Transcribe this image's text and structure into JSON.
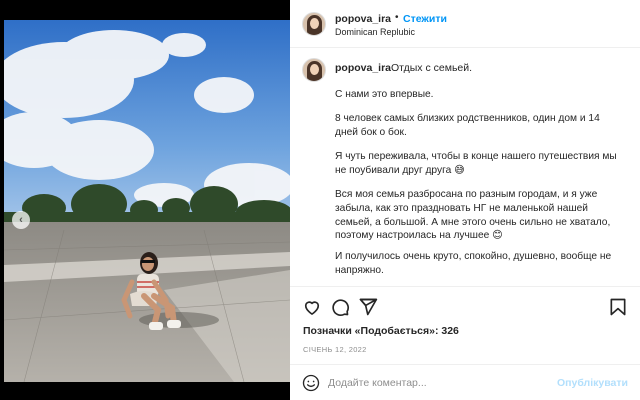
{
  "post": {
    "username": "popova_ira",
    "separator": "•",
    "follow_label": "Стежити",
    "location": "Dominican Replubic"
  },
  "caption": {
    "username": "popova_ira",
    "first_line": "Отдых с семьей.",
    "paragraphs": [
      "С нами это впервые.",
      "8 человек самых близких родственников, один дом и 14 дней бок о бок.",
      "Я чуть переживала, чтобы в конце нашего путешествия мы не поубивали друг друга 😅",
      "Вся моя семья разбросана по разным городам, и я уже забыла, как это праздновать НГ не маленькой нашей семьей, а большой. А мне этого очень сильно не хватало, поэтому настроилась на лучшее 😊",
      "И получилось очень круто, спокойно, душевно, вообще не напряжно."
    ]
  },
  "actions": {
    "icons": [
      "heart-icon",
      "comment-icon",
      "share-icon",
      "bookmark-icon"
    ],
    "likes_text": "Позначки «Подобається»: 326",
    "date_text": "СІЧЕНЬ 12, 2022"
  },
  "comment": {
    "placeholder": "Додайте коментар...",
    "publish_label": "Опублікувати"
  },
  "carousel": {
    "prev_glyph": "‹",
    "slide_count": 5,
    "active_index": 0
  },
  "colors": {
    "accent": "#0095f6",
    "publish_disabled": "#b2dffc",
    "text": "#262626",
    "muted": "#8e8e8e"
  }
}
